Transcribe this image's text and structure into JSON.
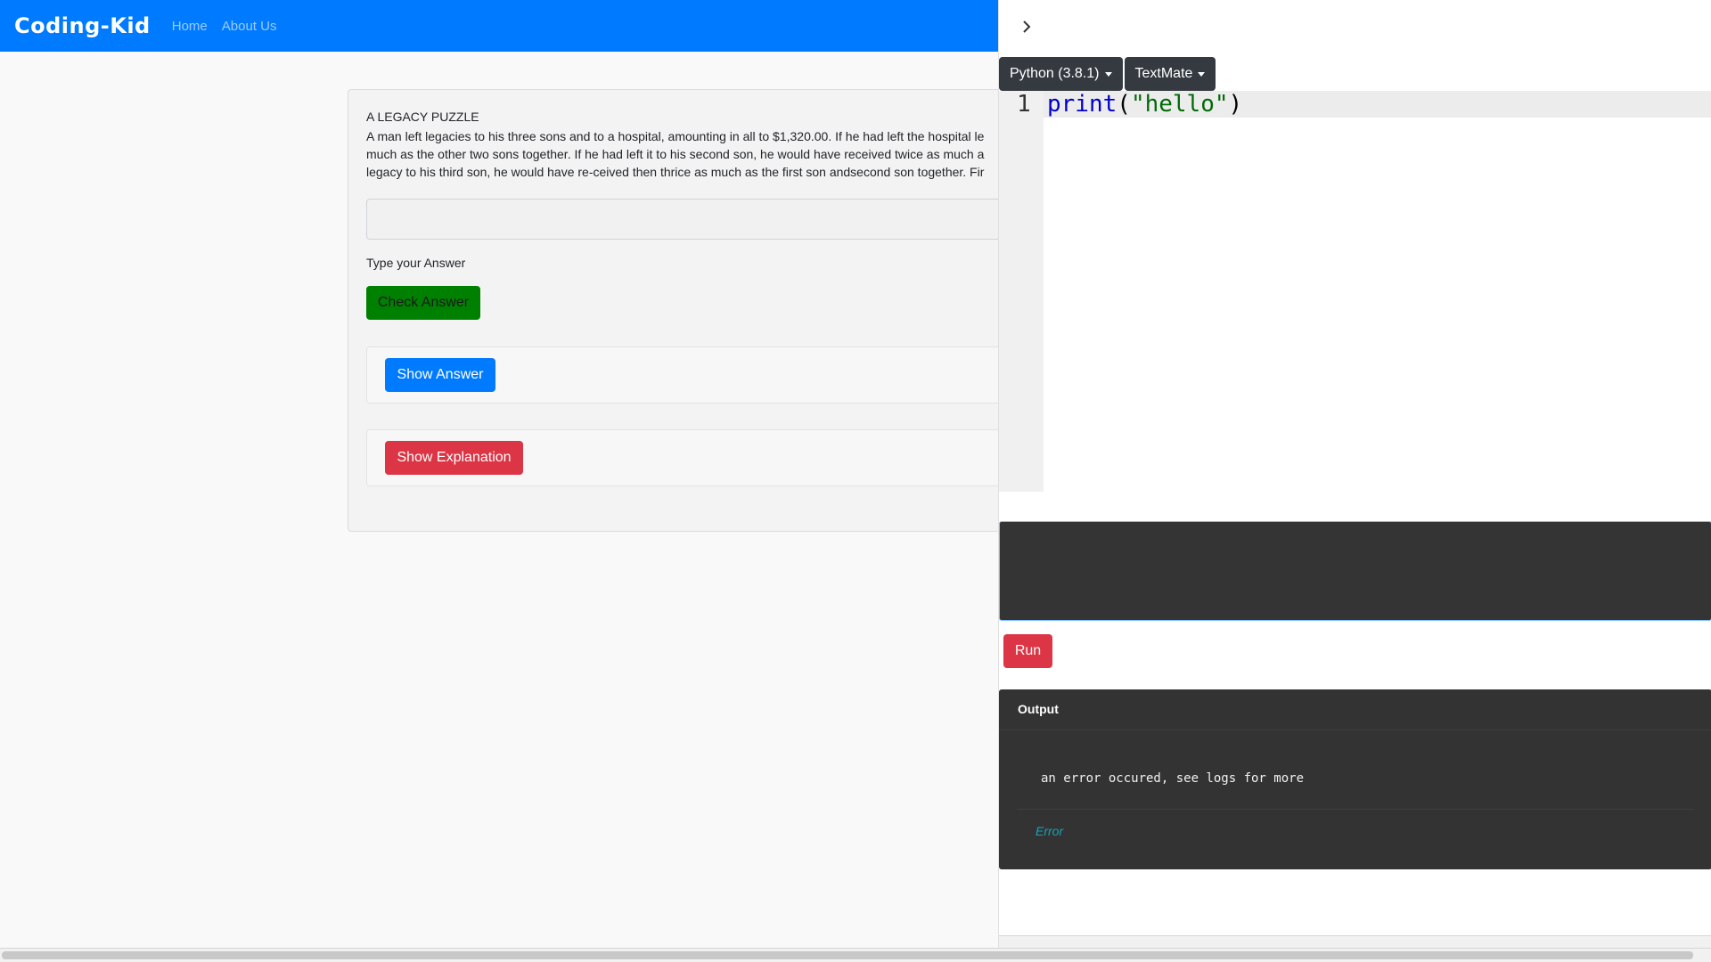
{
  "navbar": {
    "brand": "Coding-Kid",
    "links": [
      "Home",
      "About Us"
    ]
  },
  "question": {
    "title": "A LEGACY PUZZLE",
    "lines": [
      "A man left legacies to his three sons and to a hospital, amounting in all to $1,320.00. If he had left the hospital le",
      "much as the other two sons together. If he had left it to his second son, he would have received twice as much a",
      "legacy to his third son, he would have re-ceived then thrice as much as the first son andsecond son together. Fir"
    ],
    "answer_value": "",
    "answer_label": "Type your Answer",
    "check_button": "Check Answer",
    "show_answer_button": "Show Answer",
    "show_explanation_button": "Show Explanation"
  },
  "editor": {
    "language": "Python (3.8.1)",
    "theme": "TextMate",
    "line_number": "1",
    "code_tokens": {
      "fn": "print",
      "open": "(",
      "str": "\"hello\"",
      "close": ")"
    },
    "stdin_value": "",
    "run_button": "Run"
  },
  "output": {
    "title": "Output",
    "message": "an error occured, see logs for more",
    "status": "Error"
  },
  "colors": {
    "navbar": "#007bff",
    "check_button": "#008000",
    "show_answer": "#007bff",
    "danger": "#dc3545",
    "dark": "#343a40"
  }
}
